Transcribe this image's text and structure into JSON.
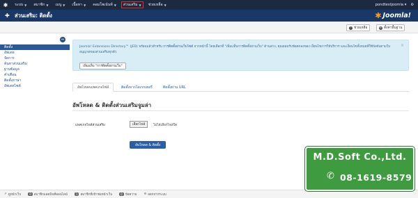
{
  "topnav": {
    "items": [
      {
        "label": "ระบบ",
        "caret": true
      },
      {
        "label": "สมาชิก",
        "caret": true
      },
      {
        "label": "เมนู",
        "caret": true
      },
      {
        "label": "เนื้อหา",
        "caret": true
      },
      {
        "label": "คอมโพเน้นท์",
        "caret": true
      },
      {
        "label": "ส่วนเสริม",
        "caret": true,
        "highlighted": true
      },
      {
        "label": "ช่วยเหลือ",
        "caret": true
      }
    ],
    "right_user": "pondtestjoomla",
    "right_user_caret": "▾",
    "right_settings": "⚙"
  },
  "header": {
    "title": "ส่วนเสริม: ติดตั้ง",
    "logo_text": "Joomla!"
  },
  "toolbar": {
    "help_label": "ช่วยเหลือ",
    "options_label": "ตั้งค่าพื้นฐาน"
  },
  "sidebar": {
    "collapse_symbol": "⇔",
    "items": [
      {
        "label": "ติดตั้ง",
        "active": true
      },
      {
        "label": "อัพเดท"
      },
      {
        "label": "จัดการ"
      },
      {
        "label": "ค้นหาส่วนเสริม"
      },
      {
        "label": "ฐานข้อมูล"
      },
      {
        "label": "คำเตือน"
      },
      {
        "label": "ติดตั้งภาษา"
      },
      {
        "label": "อัพเดทไซต์"
      }
    ]
  },
  "alert": {
    "text_intro": "Joomla! Extensions Directory™ (JED) พร้อมแล้วสำหรับ ",
    "text_link": "การติดตั้งผ่านเว็บไซต์",
    "text_rest": " จากหน้านี้ โดยเลือกที่ \"เพิ่มแท็บการติดตั้งผ่านเว็บ\" ด้านล่าง, คุณยอมรับข้อตกลงของ เงื่อนไขการให้บริการ และเงื่อนไขทั้งหมดที่ใช้บังคับตามใบอนุญาตของส่วนเสริมทุกตัว",
    "button_label": "เพิ่มแท็บ \"การติดตั้งผ่านเว็บ\"",
    "close_symbol": "×"
  },
  "tabs": [
    {
      "label": "อัพโหลดแพคเกจไฟล์",
      "active": true
    },
    {
      "label": "ติดตั้งจากไดเรกเตอรี่"
    },
    {
      "label": "ติดตั้งผ่าน URL"
    }
  ],
  "form": {
    "section_title": "อัพโหลด & ติดตั้งส่วนเสริมจูมล่า",
    "file_label": "แพคเกจไฟล์ส่วนเสริม",
    "choose_button": "เลือกไฟล์",
    "no_file_text": "ไม่ได้เลือกไฟล์ใด",
    "upload_button": "อัพโหลด & ติดตั้ง"
  },
  "footer": {
    "items": [
      {
        "label": "ดูหน้าเว็บ",
        "badge": null
      },
      {
        "label": "สมาชิกแอดมินที่ออนไลน์",
        "badge": "0"
      },
      {
        "label": "สมาชิกที่เข้าชมหน้าเว็บ",
        "badge": "1"
      },
      {
        "label": "ข้อความ",
        "badge": "0"
      },
      {
        "label": "ออกจากระบบ",
        "badge": null
      }
    ]
  },
  "watermark": {
    "company": "M.D.Soft Co.,Ltd.",
    "phone": "08-1619-8579"
  },
  "colors": {
    "topnav_bg": "#1b2a3e",
    "header_bg": "#1a3867",
    "accent_blue": "#2b5fa4",
    "alert_bg": "#d9edf7",
    "watermark_green": "#3f9b40",
    "highlight_red": "#e52b2b"
  }
}
